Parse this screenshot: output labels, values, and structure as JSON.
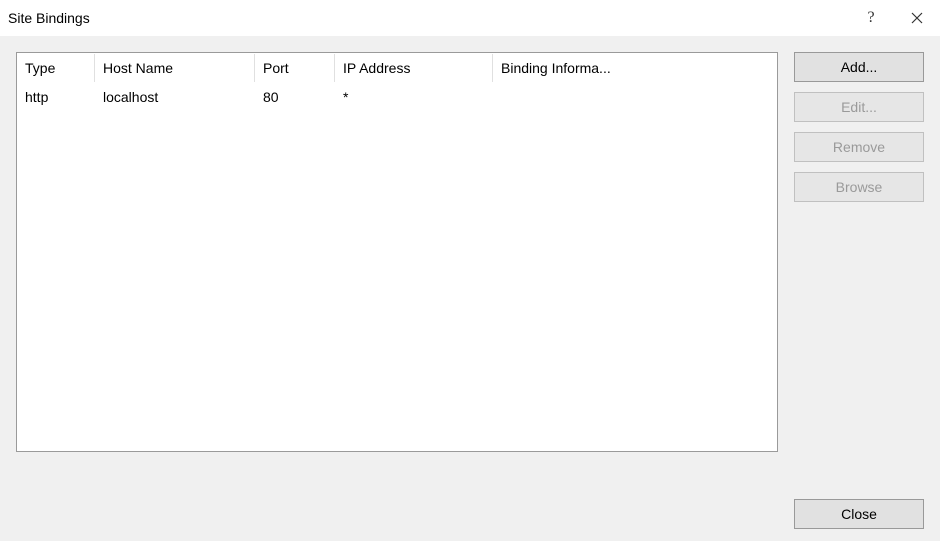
{
  "window": {
    "title": "Site Bindings",
    "help_label": "?",
    "close_label": "✕"
  },
  "columns": {
    "type": "Type",
    "host": "Host Name",
    "port": "Port",
    "ip": "IP Address",
    "binding": "Binding Informa..."
  },
  "rows": [
    {
      "type": "http",
      "host": "localhost",
      "port": "80",
      "ip": "*",
      "binding": ""
    }
  ],
  "buttons": {
    "add": "Add...",
    "edit": "Edit...",
    "remove": "Remove",
    "browse": "Browse",
    "close": "Close"
  },
  "state": {
    "edit_enabled": false,
    "remove_enabled": false,
    "browse_enabled": false
  }
}
